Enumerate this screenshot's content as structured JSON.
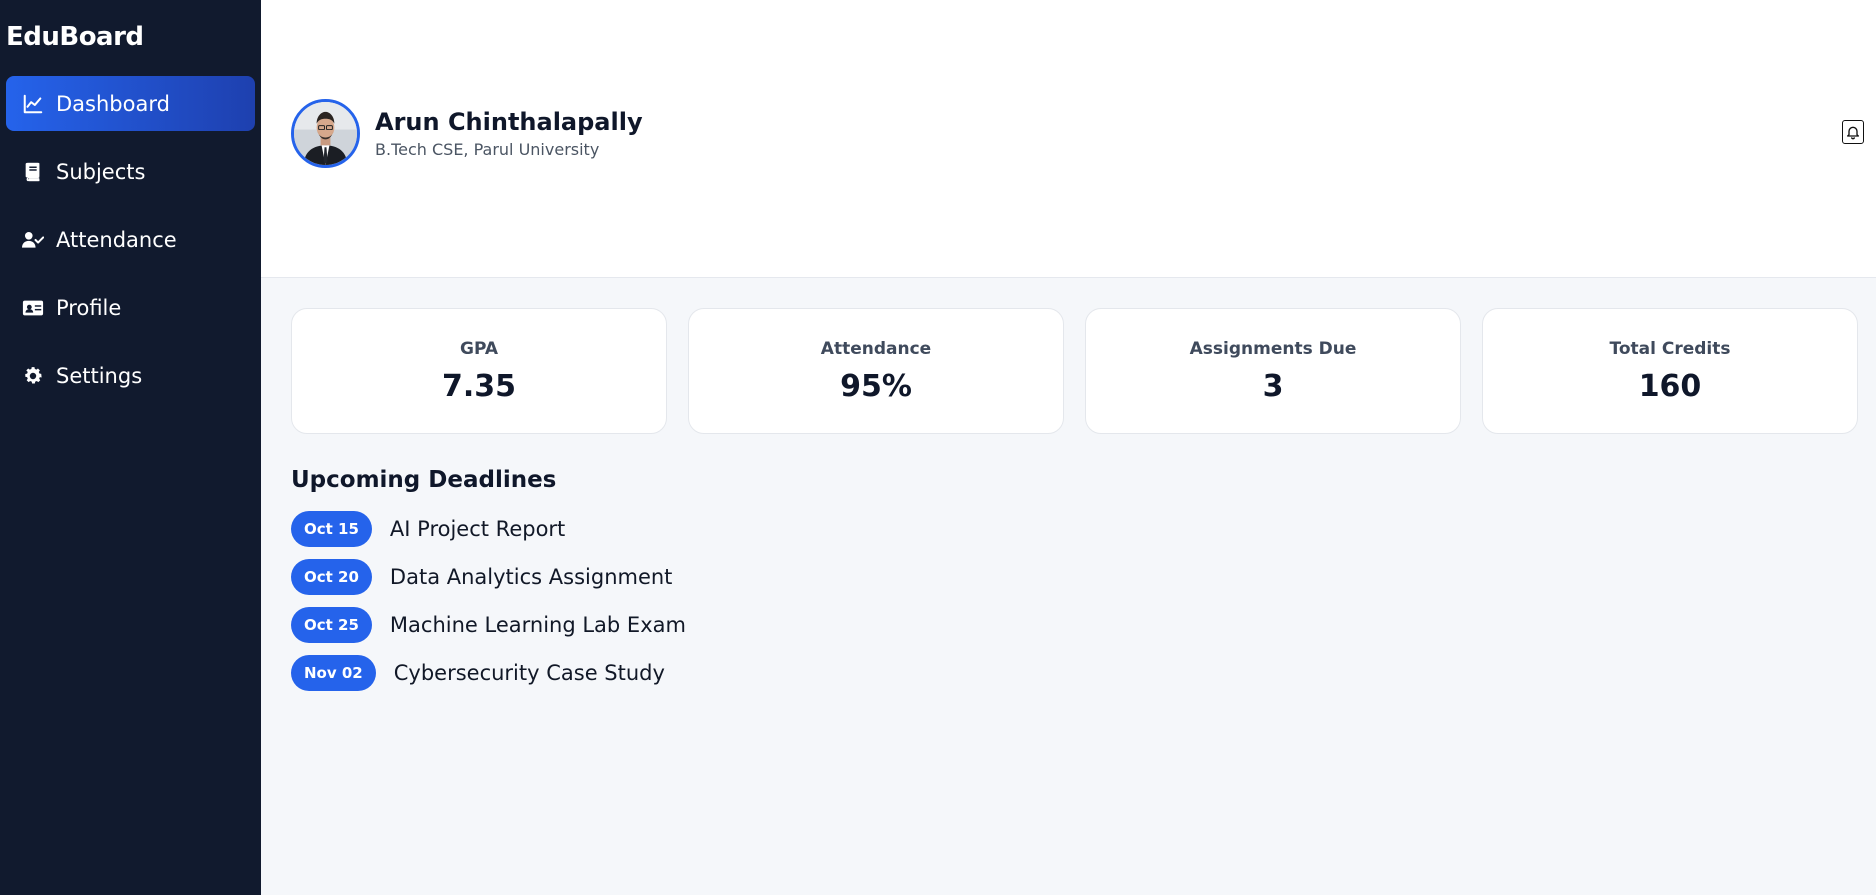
{
  "sidebar": {
    "brand": "EduBoard",
    "items": [
      {
        "label": "Dashboard",
        "icon": "chart-line-icon",
        "active": true
      },
      {
        "label": "Subjects",
        "icon": "book-icon",
        "active": false
      },
      {
        "label": "Attendance",
        "icon": "user-check-icon",
        "active": false
      },
      {
        "label": "Profile",
        "icon": "id-card-icon",
        "active": false
      },
      {
        "label": "Settings",
        "icon": "gear-icon",
        "active": false
      }
    ]
  },
  "header": {
    "name": "Arun Chinthalapally",
    "subtitle": "B.Tech CSE, Parul University",
    "bell_icon": "bell-icon"
  },
  "stats": [
    {
      "label": "GPA",
      "value": "7.35"
    },
    {
      "label": "Attendance",
      "value": "95%"
    },
    {
      "label": "Assignments Due",
      "value": "3"
    },
    {
      "label": "Total Credits",
      "value": "160"
    }
  ],
  "deadlines": {
    "title": "Upcoming Deadlines",
    "items": [
      {
        "date": "Oct 15",
        "task": "AI Project Report"
      },
      {
        "date": "Oct 20",
        "task": "Data Analytics Assignment"
      },
      {
        "date": "Oct 25",
        "task": "Machine Learning Lab Exam"
      },
      {
        "date": "Nov 02",
        "task": "Cybersecurity Case Study"
      }
    ]
  },
  "colors": {
    "sidebar_bg": "#111a2e",
    "accent": "#2563eb",
    "page_bg": "#f5f7fa"
  }
}
